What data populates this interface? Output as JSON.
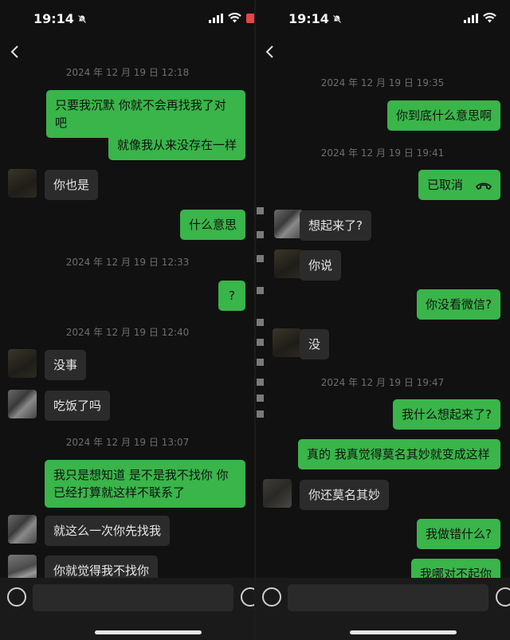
{
  "status": {
    "time": "19:14"
  },
  "left": {
    "timestamps": [
      "2024 年 12 月 19 日 12:18",
      "2024 年 12 月 19 日 12:33",
      "2024 年 12 月 19 日 12:40",
      "2024 年 12 月 19 日 13:07"
    ],
    "messages": [
      "只要我沉默 你就不会再找我了对吧",
      "就像我从来没存在一样",
      "你也是",
      "什么意思",
      "?",
      "没事",
      "吃饭了吗",
      "我只是想知道 是不是我不找你 你已经打算就这样不联系了",
      "就这么一次你先找我",
      "你就觉得我不找你"
    ]
  },
  "right": {
    "timestamps": [
      "2024 年 12 月 19 日 19:35",
      "2024 年 12 月 19 日 19:41",
      "2024 年 12 月 19 日 19:47"
    ],
    "messages": [
      "你到底什么意思啊",
      "已取消",
      "想起来了?",
      "你说",
      "你没看微信?",
      "没",
      "我什么想起来了?",
      "真的 我真觉得莫名其妙就变成这样",
      "你还莫名其妙",
      "我做错什么?",
      "我哪对不起你"
    ]
  }
}
